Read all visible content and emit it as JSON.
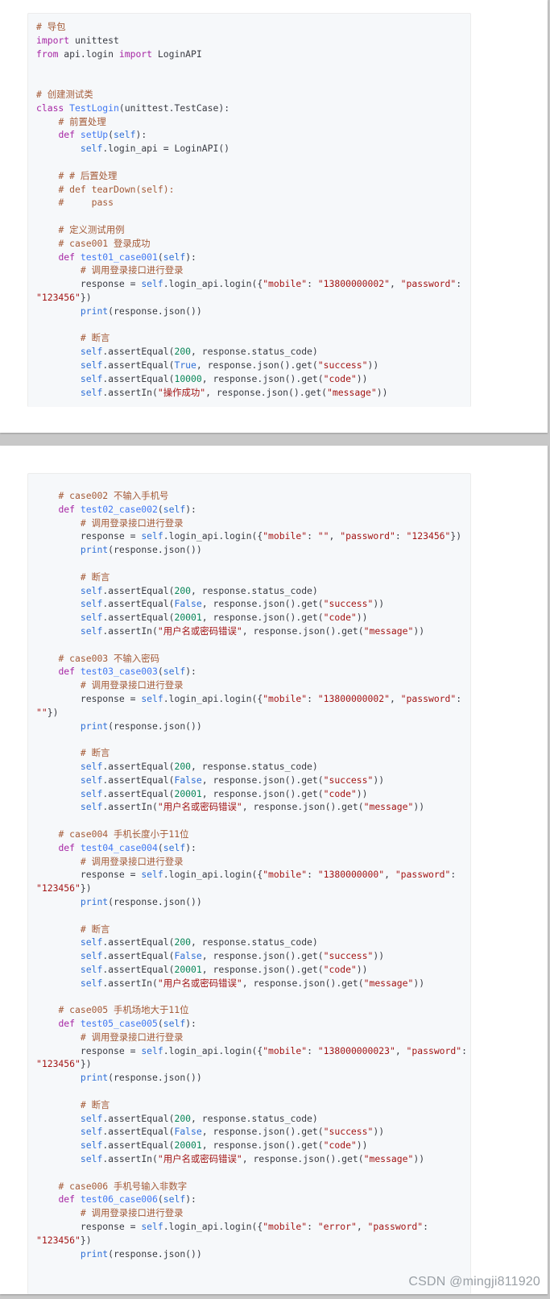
{
  "watermark": "CSDN @mingji811920",
  "colors": {
    "comment": "#a0522d",
    "keyword": "#a626a4",
    "function": "#4078f2",
    "string": "#a31515",
    "number": "#098658",
    "builtin": "#2f6fd6"
  },
  "page1_lines": [
    [
      [
        "c",
        "# 导包"
      ]
    ],
    [
      [
        "k",
        "import"
      ],
      [
        "t",
        " unittest"
      ]
    ],
    [
      [
        "k",
        "from"
      ],
      [
        "t",
        " api.login "
      ],
      [
        "k",
        "import"
      ],
      [
        "t",
        " LoginAPI"
      ]
    ],
    [],
    [],
    [
      [
        "c",
        "# 创建测试类"
      ]
    ],
    [
      [
        "k",
        "class"
      ],
      [
        "t",
        " "
      ],
      [
        "f",
        "TestLogin"
      ],
      [
        "t",
        "(unittest.TestCase):"
      ]
    ],
    [
      [
        "t",
        "    "
      ],
      [
        "c",
        "# 前置处理"
      ]
    ],
    [
      [
        "t",
        "    "
      ],
      [
        "k",
        "def"
      ],
      [
        "t",
        " "
      ],
      [
        "f",
        "setUp"
      ],
      [
        "t",
        "("
      ],
      [
        "b",
        "self"
      ],
      [
        "t",
        "):"
      ]
    ],
    [
      [
        "t",
        "        "
      ],
      [
        "b",
        "self"
      ],
      [
        "t",
        ".login_api = LoginAPI()"
      ]
    ],
    [],
    [
      [
        "t",
        "    "
      ],
      [
        "c",
        "# # 后置处理"
      ]
    ],
    [
      [
        "t",
        "    "
      ],
      [
        "c",
        "# def tearDown(self):"
      ]
    ],
    [
      [
        "t",
        "    "
      ],
      [
        "c",
        "#     pass"
      ]
    ],
    [],
    [
      [
        "t",
        "    "
      ],
      [
        "c",
        "# 定义测试用例"
      ]
    ],
    [
      [
        "t",
        "    "
      ],
      [
        "c",
        "# case001 登录成功"
      ]
    ],
    [
      [
        "t",
        "    "
      ],
      [
        "k",
        "def"
      ],
      [
        "t",
        " "
      ],
      [
        "f",
        "test01_case001"
      ],
      [
        "t",
        "("
      ],
      [
        "b",
        "self"
      ],
      [
        "t",
        "):"
      ]
    ],
    [
      [
        "t",
        "        "
      ],
      [
        "c",
        "# 调用登录接口进行登录"
      ]
    ],
    [
      [
        "t",
        "        response = "
      ],
      [
        "b",
        "self"
      ],
      [
        "t",
        ".login_api.login({"
      ],
      [
        "s",
        "\"mobile\""
      ],
      [
        "t",
        ": "
      ],
      [
        "s",
        "\"13800000002\""
      ],
      [
        "t",
        ", "
      ],
      [
        "s",
        "\"password\""
      ],
      [
        "t",
        ":"
      ]
    ],
    [
      [
        "s",
        "\"123456\""
      ],
      [
        "t",
        "})"
      ]
    ],
    [
      [
        "t",
        "        "
      ],
      [
        "b",
        "print"
      ],
      [
        "t",
        "(response.json())"
      ]
    ],
    [],
    [
      [
        "t",
        "        "
      ],
      [
        "c",
        "# 断言"
      ]
    ],
    [
      [
        "t",
        "        "
      ],
      [
        "b",
        "self"
      ],
      [
        "t",
        ".assertEqual("
      ],
      [
        "n",
        "200"
      ],
      [
        "t",
        ", response.status_code)"
      ]
    ],
    [
      [
        "t",
        "        "
      ],
      [
        "b",
        "self"
      ],
      [
        "t",
        ".assertEqual("
      ],
      [
        "b",
        "True"
      ],
      [
        "t",
        ", response.json().get("
      ],
      [
        "s",
        "\"success\""
      ],
      [
        "t",
        "))"
      ]
    ],
    [
      [
        "t",
        "        "
      ],
      [
        "b",
        "self"
      ],
      [
        "t",
        ".assertEqual("
      ],
      [
        "n",
        "10000"
      ],
      [
        "t",
        ", response.json().get("
      ],
      [
        "s",
        "\"code\""
      ],
      [
        "t",
        "))"
      ]
    ],
    [
      [
        "t",
        "        "
      ],
      [
        "b",
        "self"
      ],
      [
        "t",
        ".assertIn("
      ],
      [
        "s",
        "\"操作成功\""
      ],
      [
        "t",
        ", response.json().get("
      ],
      [
        "s",
        "\"message\""
      ],
      [
        "t",
        "))"
      ]
    ]
  ],
  "page2_lines": [
    [
      [
        "t",
        "    "
      ],
      [
        "c",
        "# case002 不输入手机号"
      ]
    ],
    [
      [
        "t",
        "    "
      ],
      [
        "k",
        "def"
      ],
      [
        "t",
        " "
      ],
      [
        "f",
        "test02_case002"
      ],
      [
        "t",
        "("
      ],
      [
        "b",
        "self"
      ],
      [
        "t",
        "):"
      ]
    ],
    [
      [
        "t",
        "        "
      ],
      [
        "c",
        "# 调用登录接口进行登录"
      ]
    ],
    [
      [
        "t",
        "        response = "
      ],
      [
        "b",
        "self"
      ],
      [
        "t",
        ".login_api.login({"
      ],
      [
        "s",
        "\"mobile\""
      ],
      [
        "t",
        ": "
      ],
      [
        "s",
        "\"\""
      ],
      [
        "t",
        ", "
      ],
      [
        "s",
        "\"password\""
      ],
      [
        "t",
        ": "
      ],
      [
        "s",
        "\"123456\""
      ],
      [
        "t",
        "})"
      ]
    ],
    [
      [
        "t",
        "        "
      ],
      [
        "b",
        "print"
      ],
      [
        "t",
        "(response.json())"
      ]
    ],
    [],
    [
      [
        "t",
        "        "
      ],
      [
        "c",
        "# 断言"
      ]
    ],
    [
      [
        "t",
        "        "
      ],
      [
        "b",
        "self"
      ],
      [
        "t",
        ".assertEqual("
      ],
      [
        "n",
        "200"
      ],
      [
        "t",
        ", response.status_code)"
      ]
    ],
    [
      [
        "t",
        "        "
      ],
      [
        "b",
        "self"
      ],
      [
        "t",
        ".assertEqual("
      ],
      [
        "b",
        "False"
      ],
      [
        "t",
        ", response.json().get("
      ],
      [
        "s",
        "\"success\""
      ],
      [
        "t",
        "))"
      ]
    ],
    [
      [
        "t",
        "        "
      ],
      [
        "b",
        "self"
      ],
      [
        "t",
        ".assertEqual("
      ],
      [
        "n",
        "20001"
      ],
      [
        "t",
        ", response.json().get("
      ],
      [
        "s",
        "\"code\""
      ],
      [
        "t",
        "))"
      ]
    ],
    [
      [
        "t",
        "        "
      ],
      [
        "b",
        "self"
      ],
      [
        "t",
        ".assertIn("
      ],
      [
        "s",
        "\"用户名或密码错误\""
      ],
      [
        "t",
        ", response.json().get("
      ],
      [
        "s",
        "\"message\""
      ],
      [
        "t",
        "))"
      ]
    ],
    [],
    [
      [
        "t",
        "    "
      ],
      [
        "c",
        "# case003 不输入密码"
      ]
    ],
    [
      [
        "t",
        "    "
      ],
      [
        "k",
        "def"
      ],
      [
        "t",
        " "
      ],
      [
        "f",
        "test03_case003"
      ],
      [
        "t",
        "("
      ],
      [
        "b",
        "self"
      ],
      [
        "t",
        "):"
      ]
    ],
    [
      [
        "t",
        "        "
      ],
      [
        "c",
        "# 调用登录接口进行登录"
      ]
    ],
    [
      [
        "t",
        "        response = "
      ],
      [
        "b",
        "self"
      ],
      [
        "t",
        ".login_api.login({"
      ],
      [
        "s",
        "\"mobile\""
      ],
      [
        "t",
        ": "
      ],
      [
        "s",
        "\"13800000002\""
      ],
      [
        "t",
        ", "
      ],
      [
        "s",
        "\"password\""
      ],
      [
        "t",
        ":"
      ]
    ],
    [
      [
        "s",
        "\"\""
      ],
      [
        "t",
        "})"
      ]
    ],
    [
      [
        "t",
        "        "
      ],
      [
        "b",
        "print"
      ],
      [
        "t",
        "(response.json())"
      ]
    ],
    [],
    [
      [
        "t",
        "        "
      ],
      [
        "c",
        "# 断言"
      ]
    ],
    [
      [
        "t",
        "        "
      ],
      [
        "b",
        "self"
      ],
      [
        "t",
        ".assertEqual("
      ],
      [
        "n",
        "200"
      ],
      [
        "t",
        ", response.status_code)"
      ]
    ],
    [
      [
        "t",
        "        "
      ],
      [
        "b",
        "self"
      ],
      [
        "t",
        ".assertEqual("
      ],
      [
        "b",
        "False"
      ],
      [
        "t",
        ", response.json().get("
      ],
      [
        "s",
        "\"success\""
      ],
      [
        "t",
        "))"
      ]
    ],
    [
      [
        "t",
        "        "
      ],
      [
        "b",
        "self"
      ],
      [
        "t",
        ".assertEqual("
      ],
      [
        "n",
        "20001"
      ],
      [
        "t",
        ", response.json().get("
      ],
      [
        "s",
        "\"code\""
      ],
      [
        "t",
        "))"
      ]
    ],
    [
      [
        "t",
        "        "
      ],
      [
        "b",
        "self"
      ],
      [
        "t",
        ".assertIn("
      ],
      [
        "s",
        "\"用户名或密码错误\""
      ],
      [
        "t",
        ", response.json().get("
      ],
      [
        "s",
        "\"message\""
      ],
      [
        "t",
        "))"
      ]
    ],
    [],
    [
      [
        "t",
        "    "
      ],
      [
        "c",
        "# case004 手机长度小于11位"
      ]
    ],
    [
      [
        "t",
        "    "
      ],
      [
        "k",
        "def"
      ],
      [
        "t",
        " "
      ],
      [
        "f",
        "test04_case004"
      ],
      [
        "t",
        "("
      ],
      [
        "b",
        "self"
      ],
      [
        "t",
        "):"
      ]
    ],
    [
      [
        "t",
        "        "
      ],
      [
        "c",
        "# 调用登录接口进行登录"
      ]
    ],
    [
      [
        "t",
        "        response = "
      ],
      [
        "b",
        "self"
      ],
      [
        "t",
        ".login_api.login({"
      ],
      [
        "s",
        "\"mobile\""
      ],
      [
        "t",
        ": "
      ],
      [
        "s",
        "\"1380000000\""
      ],
      [
        "t",
        ", "
      ],
      [
        "s",
        "\"password\""
      ],
      [
        "t",
        ":"
      ]
    ],
    [
      [
        "s",
        "\"123456\""
      ],
      [
        "t",
        "})"
      ]
    ],
    [
      [
        "t",
        "        "
      ],
      [
        "b",
        "print"
      ],
      [
        "t",
        "(response.json())"
      ]
    ],
    [],
    [
      [
        "t",
        "        "
      ],
      [
        "c",
        "# 断言"
      ]
    ],
    [
      [
        "t",
        "        "
      ],
      [
        "b",
        "self"
      ],
      [
        "t",
        ".assertEqual("
      ],
      [
        "n",
        "200"
      ],
      [
        "t",
        ", response.status_code)"
      ]
    ],
    [
      [
        "t",
        "        "
      ],
      [
        "b",
        "self"
      ],
      [
        "t",
        ".assertEqual("
      ],
      [
        "b",
        "False"
      ],
      [
        "t",
        ", response.json().get("
      ],
      [
        "s",
        "\"success\""
      ],
      [
        "t",
        "))"
      ]
    ],
    [
      [
        "t",
        "        "
      ],
      [
        "b",
        "self"
      ],
      [
        "t",
        ".assertEqual("
      ],
      [
        "n",
        "20001"
      ],
      [
        "t",
        ", response.json().get("
      ],
      [
        "s",
        "\"code\""
      ],
      [
        "t",
        "))"
      ]
    ],
    [
      [
        "t",
        "        "
      ],
      [
        "b",
        "self"
      ],
      [
        "t",
        ".assertIn("
      ],
      [
        "s",
        "\"用户名或密码错误\""
      ],
      [
        "t",
        ", response.json().get("
      ],
      [
        "s",
        "\"message\""
      ],
      [
        "t",
        "))"
      ]
    ],
    [],
    [
      [
        "t",
        "    "
      ],
      [
        "c",
        "# case005 手机场地大于11位"
      ]
    ],
    [
      [
        "t",
        "    "
      ],
      [
        "k",
        "def"
      ],
      [
        "t",
        " "
      ],
      [
        "f",
        "test05_case005"
      ],
      [
        "t",
        "("
      ],
      [
        "b",
        "self"
      ],
      [
        "t",
        "):"
      ]
    ],
    [
      [
        "t",
        "        "
      ],
      [
        "c",
        "# 调用登录接口进行登录"
      ]
    ],
    [
      [
        "t",
        "        response = "
      ],
      [
        "b",
        "self"
      ],
      [
        "t",
        ".login_api.login({"
      ],
      [
        "s",
        "\"mobile\""
      ],
      [
        "t",
        ": "
      ],
      [
        "s",
        "\"138000000023\""
      ],
      [
        "t",
        ", "
      ],
      [
        "s",
        "\"password\""
      ],
      [
        "t",
        ":"
      ]
    ],
    [
      [
        "s",
        "\"123456\""
      ],
      [
        "t",
        "})"
      ]
    ],
    [
      [
        "t",
        "        "
      ],
      [
        "b",
        "print"
      ],
      [
        "t",
        "(response.json())"
      ]
    ],
    [],
    [
      [
        "t",
        "        "
      ],
      [
        "c",
        "# 断言"
      ]
    ],
    [
      [
        "t",
        "        "
      ],
      [
        "b",
        "self"
      ],
      [
        "t",
        ".assertEqual("
      ],
      [
        "n",
        "200"
      ],
      [
        "t",
        ", response.status_code)"
      ]
    ],
    [
      [
        "t",
        "        "
      ],
      [
        "b",
        "self"
      ],
      [
        "t",
        ".assertEqual("
      ],
      [
        "b",
        "False"
      ],
      [
        "t",
        ", response.json().get("
      ],
      [
        "s",
        "\"success\""
      ],
      [
        "t",
        "))"
      ]
    ],
    [
      [
        "t",
        "        "
      ],
      [
        "b",
        "self"
      ],
      [
        "t",
        ".assertEqual("
      ],
      [
        "n",
        "20001"
      ],
      [
        "t",
        ", response.json().get("
      ],
      [
        "s",
        "\"code\""
      ],
      [
        "t",
        "))"
      ]
    ],
    [
      [
        "t",
        "        "
      ],
      [
        "b",
        "self"
      ],
      [
        "t",
        ".assertIn("
      ],
      [
        "s",
        "\"用户名或密码错误\""
      ],
      [
        "t",
        ", response.json().get("
      ],
      [
        "s",
        "\"message\""
      ],
      [
        "t",
        "))"
      ]
    ],
    [],
    [
      [
        "t",
        "    "
      ],
      [
        "c",
        "# case006 手机号输入非数字"
      ]
    ],
    [
      [
        "t",
        "    "
      ],
      [
        "k",
        "def"
      ],
      [
        "t",
        " "
      ],
      [
        "f",
        "test06_case006"
      ],
      [
        "t",
        "("
      ],
      [
        "b",
        "self"
      ],
      [
        "t",
        "):"
      ]
    ],
    [
      [
        "t",
        "        "
      ],
      [
        "c",
        "# 调用登录接口进行登录"
      ]
    ],
    [
      [
        "t",
        "        response = "
      ],
      [
        "b",
        "self"
      ],
      [
        "t",
        ".login_api.login({"
      ],
      [
        "s",
        "\"mobile\""
      ],
      [
        "t",
        ": "
      ],
      [
        "s",
        "\"error\""
      ],
      [
        "t",
        ", "
      ],
      [
        "s",
        "\"password\""
      ],
      [
        "t",
        ":"
      ]
    ],
    [
      [
        "s",
        "\"123456\""
      ],
      [
        "t",
        "})"
      ]
    ],
    [
      [
        "t",
        "        "
      ],
      [
        "b",
        "print"
      ],
      [
        "t",
        "(response.json())"
      ]
    ]
  ]
}
